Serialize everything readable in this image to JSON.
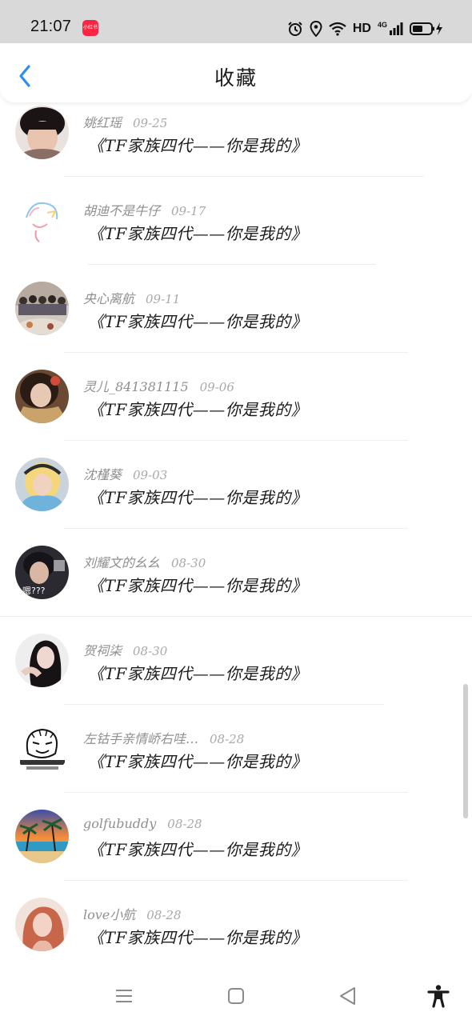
{
  "status_bar": {
    "time": "21:07",
    "app_badge": "小红书",
    "hd": "HD",
    "network": "4G",
    "icons": [
      "alarm-icon",
      "location-icon",
      "wifi-icon",
      "signal-icon",
      "battery-charging-icon"
    ]
  },
  "header": {
    "title": "收藏",
    "back_icon": "chevron-left-icon",
    "accent_color": "#2b8ef0"
  },
  "items": [
    {
      "user": "姚红瑶",
      "date": "09-25",
      "title": "《TF家族四代——你是我的》"
    },
    {
      "user": "胡迪不是牛仔",
      "date": "09-17",
      "title": "《TF家族四代——你是我的》"
    },
    {
      "user": "央心离航",
      "date": "09-11",
      "title": "《TF家族四代——你是我的》"
    },
    {
      "user": "灵儿_841381115",
      "date": "09-06",
      "title": "《TF家族四代——你是我的》"
    },
    {
      "user": "沈槿葵",
      "date": "09-03",
      "title": "《TF家族四代——你是我的》"
    },
    {
      "user": "刘耀文的幺幺",
      "date": "08-30",
      "title": "《TF家族四代——你是我的》"
    },
    {
      "user": "贺祠柒",
      "date": "08-30",
      "title": "《TF家族四代——你是我的》"
    },
    {
      "user": "左钴手亲情峤右哇…",
      "date": "08-28",
      "title": "《TF家族四代——你是我的》"
    },
    {
      "user": "golfubuddy",
      "date": "08-28",
      "title": "《TF家族四代——你是我的》"
    },
    {
      "user": "love小航",
      "date": "08-28",
      "title": "《TF家族四代——你是我的》"
    }
  ],
  "nav_bar": {
    "icons": [
      "menu-icon",
      "home-icon",
      "back-triangle-icon",
      "accessibility-icon"
    ]
  }
}
